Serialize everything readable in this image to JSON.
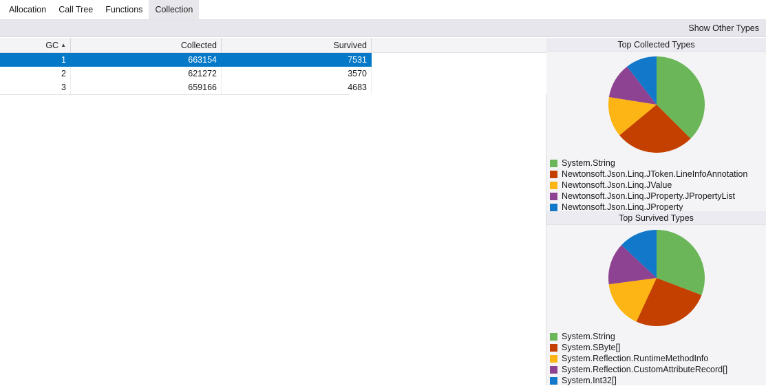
{
  "tabs": [
    {
      "label": "Allocation",
      "selected": false
    },
    {
      "label": "Call Tree",
      "selected": false
    },
    {
      "label": "Functions",
      "selected": false
    },
    {
      "label": "Collection",
      "selected": true
    }
  ],
  "toolbar": {
    "show_other_types_label": "Show Other Types"
  },
  "grid": {
    "columns": [
      {
        "label": "GC",
        "sorted": true,
        "sort_glyph": "▲"
      },
      {
        "label": "Collected",
        "sorted": false,
        "sort_glyph": ""
      },
      {
        "label": "Survived",
        "sorted": false,
        "sort_glyph": ""
      },
      {
        "label": "",
        "sorted": false,
        "sort_glyph": ""
      }
    ],
    "rows": [
      {
        "gc": "1",
        "collected": "663154",
        "survived": "7531",
        "selected": true
      },
      {
        "gc": "2",
        "collected": "621272",
        "survived": "3570",
        "selected": false
      },
      {
        "gc": "3",
        "collected": "659166",
        "survived": "4683",
        "selected": false
      }
    ]
  },
  "colors": {
    "series": [
      "#6cb65a",
      "#c44000",
      "#fcb514",
      "#8e4292",
      "#1279ca"
    ],
    "selection": "#0579c8",
    "panel_header_bg": "#ebebf1",
    "panel_bg": "#f4f4f6",
    "toolbar_bg": "#e6e6ec"
  },
  "chart_data": [
    {
      "type": "pie",
      "title": "Top Collected Types",
      "legend_position": "bottom-left",
      "categories": [
        "System.String",
        "Newtonsoft.Json.Linq.JToken.LineInfoAnnotation",
        "Newtonsoft.Json.Linq.JValue",
        "Newtonsoft.Json.Linq.JProperty.JPropertyList",
        "Newtonsoft.Json.Linq.JProperty"
      ],
      "values": [
        37.5,
        26.5,
        13.5,
        12.0,
        10.5
      ],
      "colors": [
        "#6cb65a",
        "#c44000",
        "#fcb514",
        "#8e4292",
        "#1279ca"
      ],
      "start_angle_deg": 0,
      "direction": "clockwise",
      "xlabel": "",
      "ylabel": ""
    },
    {
      "type": "pie",
      "title": "Top Survived Types",
      "legend_position": "bottom-left",
      "categories": [
        "System.String",
        "System.SByte[]",
        "System.Reflection.RuntimeMethodInfo",
        "System.Reflection.CustomAttributeRecord[]",
        "System.Int32[]"
      ],
      "values": [
        30.8,
        26.1,
        16.0,
        14.1,
        13.0
      ],
      "colors": [
        "#6cb65a",
        "#c44000",
        "#fcb514",
        "#8e4292",
        "#1279ca"
      ],
      "start_angle_deg": 0,
      "direction": "clockwise",
      "xlabel": "",
      "ylabel": ""
    }
  ]
}
